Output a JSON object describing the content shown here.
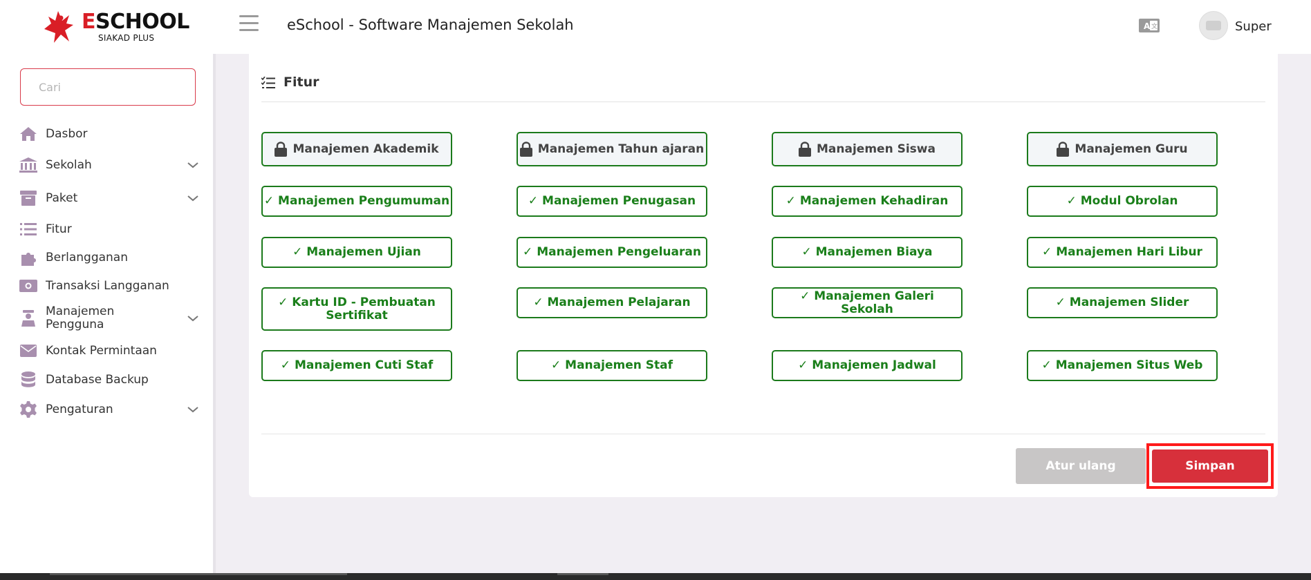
{
  "header": {
    "logo_brand_first": "E",
    "logo_brand_rest": "SCHOOL",
    "logo_sub": "SIAKAD PLUS",
    "app_title": "eSchool - Software Manajemen Sekolah",
    "user_name": "Super",
    "icons": [
      "menu-icon",
      "language-icon",
      "avatar"
    ]
  },
  "sidebar": {
    "search_placeholder": "Cari",
    "items": [
      {
        "label": "Dasbor",
        "icon": "home-icon",
        "has_submenu": false
      },
      {
        "label": "Sekolah",
        "icon": "school-icon",
        "has_submenu": true
      },
      {
        "label": "Paket",
        "icon": "package-icon",
        "has_submenu": true
      },
      {
        "label": "Fitur",
        "icon": "list-icon",
        "has_submenu": false
      },
      {
        "label": "Berlangganan",
        "icon": "puzzle-icon",
        "has_submenu": false
      },
      {
        "label": "Transaksi Langganan",
        "icon": "money-icon",
        "has_submenu": false
      },
      {
        "label": "Manajemen Pengguna",
        "icon": "users-icon",
        "has_submenu": true
      },
      {
        "label": "Kontak Permintaan",
        "icon": "mail-icon",
        "has_submenu": false
      },
      {
        "label": "Database Backup",
        "icon": "database-icon",
        "has_submenu": false
      },
      {
        "label": "Pengaturan",
        "icon": "gear-icon",
        "has_submenu": true
      }
    ]
  },
  "main": {
    "section_title": "Fitur",
    "features": [
      {
        "label": "Manajemen Akademik",
        "locked": true
      },
      {
        "label": "Manajemen Tahun ajaran",
        "locked": true
      },
      {
        "label": "Manajemen Siswa",
        "locked": true
      },
      {
        "label": "Manajemen Guru",
        "locked": true
      },
      {
        "label": "✓ Manajemen Pengumuman",
        "locked": false
      },
      {
        "label": "✓ Manajemen Penugasan",
        "locked": false
      },
      {
        "label": "✓ Manajemen Kehadiran",
        "locked": false
      },
      {
        "label": "✓ Modul Obrolan",
        "locked": false
      },
      {
        "label": "✓ Manajemen Ujian",
        "locked": false
      },
      {
        "label": "✓ Manajemen Pengeluaran",
        "locked": false
      },
      {
        "label": "✓ Manajemen Biaya",
        "locked": false
      },
      {
        "label": "✓ Manajemen Hari Libur",
        "locked": false
      },
      {
        "label": "✓ Kartu ID - Pembuatan Sertifikat",
        "locked": false
      },
      {
        "label": "✓ Manajemen Pelajaran",
        "locked": false
      },
      {
        "label": "✓ Manajemen Galeri Sekolah",
        "locked": false
      },
      {
        "label": "✓ Manajemen Slider",
        "locked": false
      },
      {
        "label": "✓ Manajemen Cuti Staf",
        "locked": false
      },
      {
        "label": "✓ Manajemen Staf",
        "locked": false
      },
      {
        "label": "✓ Manajemen Jadwal",
        "locked": false
      },
      {
        "label": "✓ Manajemen Situs Web",
        "locked": false
      }
    ],
    "reset_label": "Atur ulang",
    "save_label": "Simpan"
  },
  "colors": {
    "accent": "#d7303b",
    "feature_green": "#1a7f1a",
    "sidebar_icon": "#a88fae",
    "highlight_border": "#ff1a1a"
  }
}
